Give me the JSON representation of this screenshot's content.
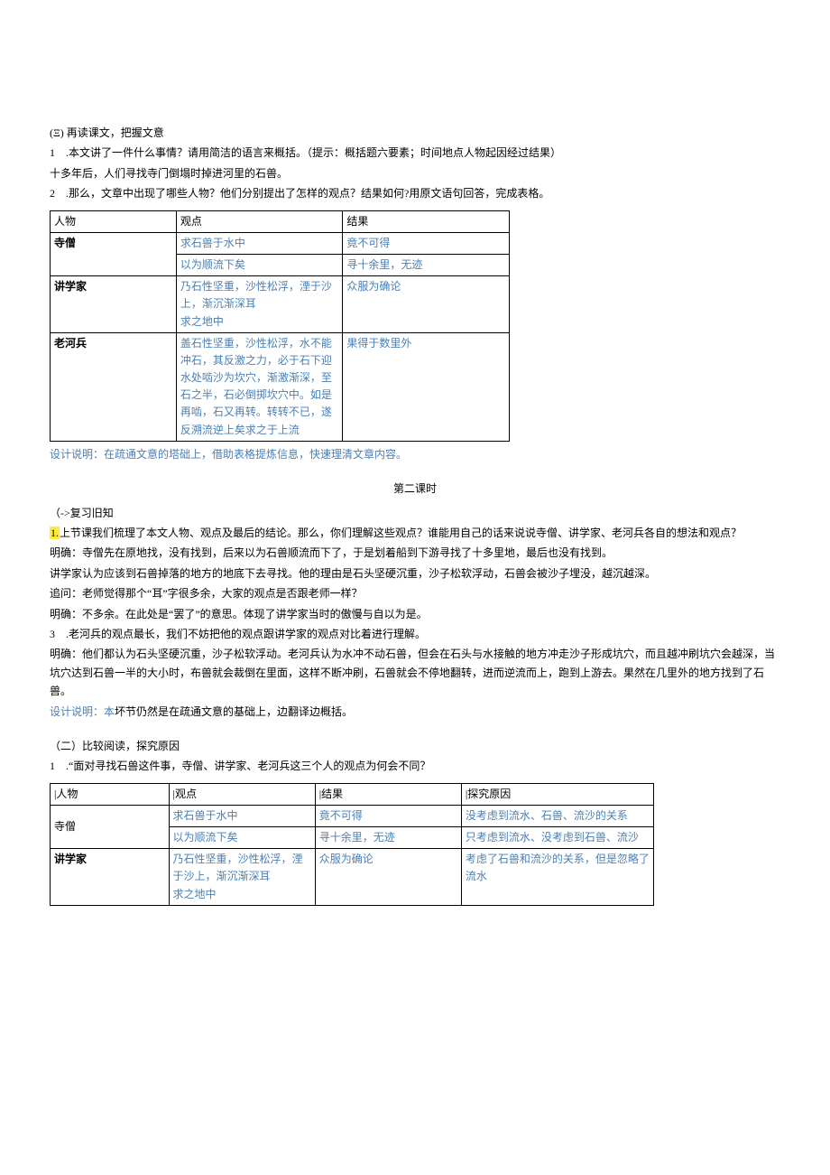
{
  "sec1": {
    "title": "(Ξ) 再读课文，把握文意",
    "q1": "1　.本文讲了一件什么事情？请用简洁的语言来概括。（提示：概括题六要素；时间地点人物起因经过结果）",
    "a1": "十多年后，人们寻找寺门倒塌时掉进河里的石兽。",
    "q2": "2　.那么，文章中出现了哪些人物？他们分别提出了怎样的观点？结果如何?用原文语句回答，完成表格。"
  },
  "table1": {
    "headers": [
      "人物",
      "观点",
      "结果"
    ],
    "rows": [
      {
        "role": "寺僧",
        "view1": "求石兽于水中",
        "res1": "竟不可得",
        "view2": "以为顺流下矣",
        "res2": "寻十余里，无迹"
      },
      {
        "role": "讲学家",
        "view": "乃石性坚重，沙性松浮，湮于沙上，渐沉渐深耳\n求之地中",
        "res": "众服为确论"
      },
      {
        "role": "老河兵",
        "view": "盖石性坚重，沙性松浮，水不能冲石，其反激之力，必于石下迎水处啮沙为坎穴，渐激渐深，至石之半，石必倒掷坎穴中。如是再啮，石又再转。转转不已，遂反溯流逆上矣求之于上流",
        "res": "果得于数里外"
      }
    ]
  },
  "note1": "设计说明：在疏通文意的塔础上，借助表格提炼信息，快速理清文章内容。",
  "lesson2": {
    "title": "第二课时",
    "sub1": "（->复习旧知",
    "p1_label": "1.",
    "p1": "上节课我们梳理了本文人物、观点及最后的结论。那么，你们理解这些观点？谁能用自己的话来说说寺僧、讲学家、老河兵各自的想法和观点？",
    "p2": "明确：寺僧先在原地找，没有找到，后来以为石兽顺流而下了，于是划着船到下游寻找了十多里地，最后也没有找到。",
    "p3": "讲学家认为应该到石兽掉落的地方的地底下去寻找。他的理由是石头坚硬沉重，沙子松软浮动，石兽会被沙子埋没，越沉越深。",
    "p4": "追问：老师觉得那个“耳”字很多余，大家的观点是否跟老师一样？",
    "p5": "明确：不多余。在此处是“罢了”的意思。体现了讲学家当时的傲慢与自以为是。",
    "p6": "3　.老河兵的观点最长，我们不妨把他的观点跟讲学家的观点对比着进行理解。",
    "p7": "明确：他们都认为石头坚硬沉重，沙子松软浮动。老河兵认为水冲不动石兽，但会在石头与水接触的地方冲走沙子形成坑穴，而且越冲刷坑穴会越深，当坑穴达到石兽一半的大小时，布兽就会裁倒在里面，这样不断冲刷，石兽就会不停地翻转，进而逆流而上，跑到上游去。果然在几里外的地方找到了石兽。",
    "note2a": "设计说明：本",
    "note2b": "坏节仍然是在疏通文意的基础上，边翻译边概括。"
  },
  "sec2": {
    "title": "（二）比较阅读，探究原因",
    "q1": "1　.“面对寻找石兽这件事，寺僧、讲学家、老河兵这三个人的观点为何会不同？"
  },
  "table2": {
    "headers": [
      "|人物",
      "|观点",
      "|结果",
      "|探究原因"
    ],
    "rows": [
      {
        "role": "寺僧",
        "cells": [
          {
            "view": "求石兽于水中",
            "res": "竟不可得",
            "reason": "没考虑到流水、石兽、流沙的关系"
          },
          {
            "view": "以为顺流下矣",
            "res": "寻十余里，无迹",
            "reason": "只考虑到流水、没考虑到石兽、流沙"
          }
        ]
      },
      {
        "role": "讲学家",
        "cells": [
          {
            "view": "乃石性坚重，沙性松浮，湮于沙上，渐沉渐深耳\n求之地中",
            "res": "众服为确论",
            "reason": "考虑了石兽和流沙的关系，但是忽略了流水"
          }
        ]
      }
    ]
  }
}
